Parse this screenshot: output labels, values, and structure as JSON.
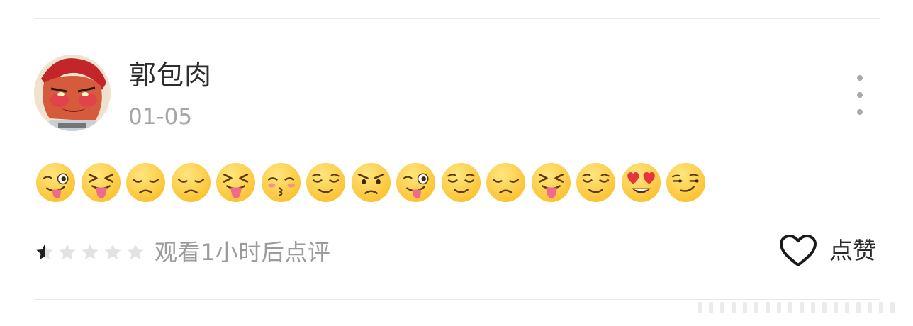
{
  "post": {
    "username": "郭包肉",
    "date": "01-05",
    "emojis": [
      "winking-tongue-face",
      "squinting-tongue-face",
      "disappointed-face",
      "disappointed-face",
      "squinting-tongue-face",
      "kissing-closed-eyes-face",
      "relieved-face",
      "angry-face",
      "winking-tongue-face",
      "relieved-face",
      "disappointed-face",
      "squinting-tongue-face",
      "relieved-face",
      "heart-eyes-face",
      "smirking-face"
    ]
  },
  "rating": {
    "value": 0.5,
    "max": 5,
    "hint": "观看1小时后点评"
  },
  "actions": {
    "like_label": "点赞",
    "more_icon": "more-vertical-icon",
    "like_icon": "heart-outline-icon"
  },
  "colors": {
    "emoji_face": "#fbc02d",
    "star_empty": "#e2e2e2",
    "star_filled": "#1e1e1e",
    "divider": "#e9e9e9"
  }
}
